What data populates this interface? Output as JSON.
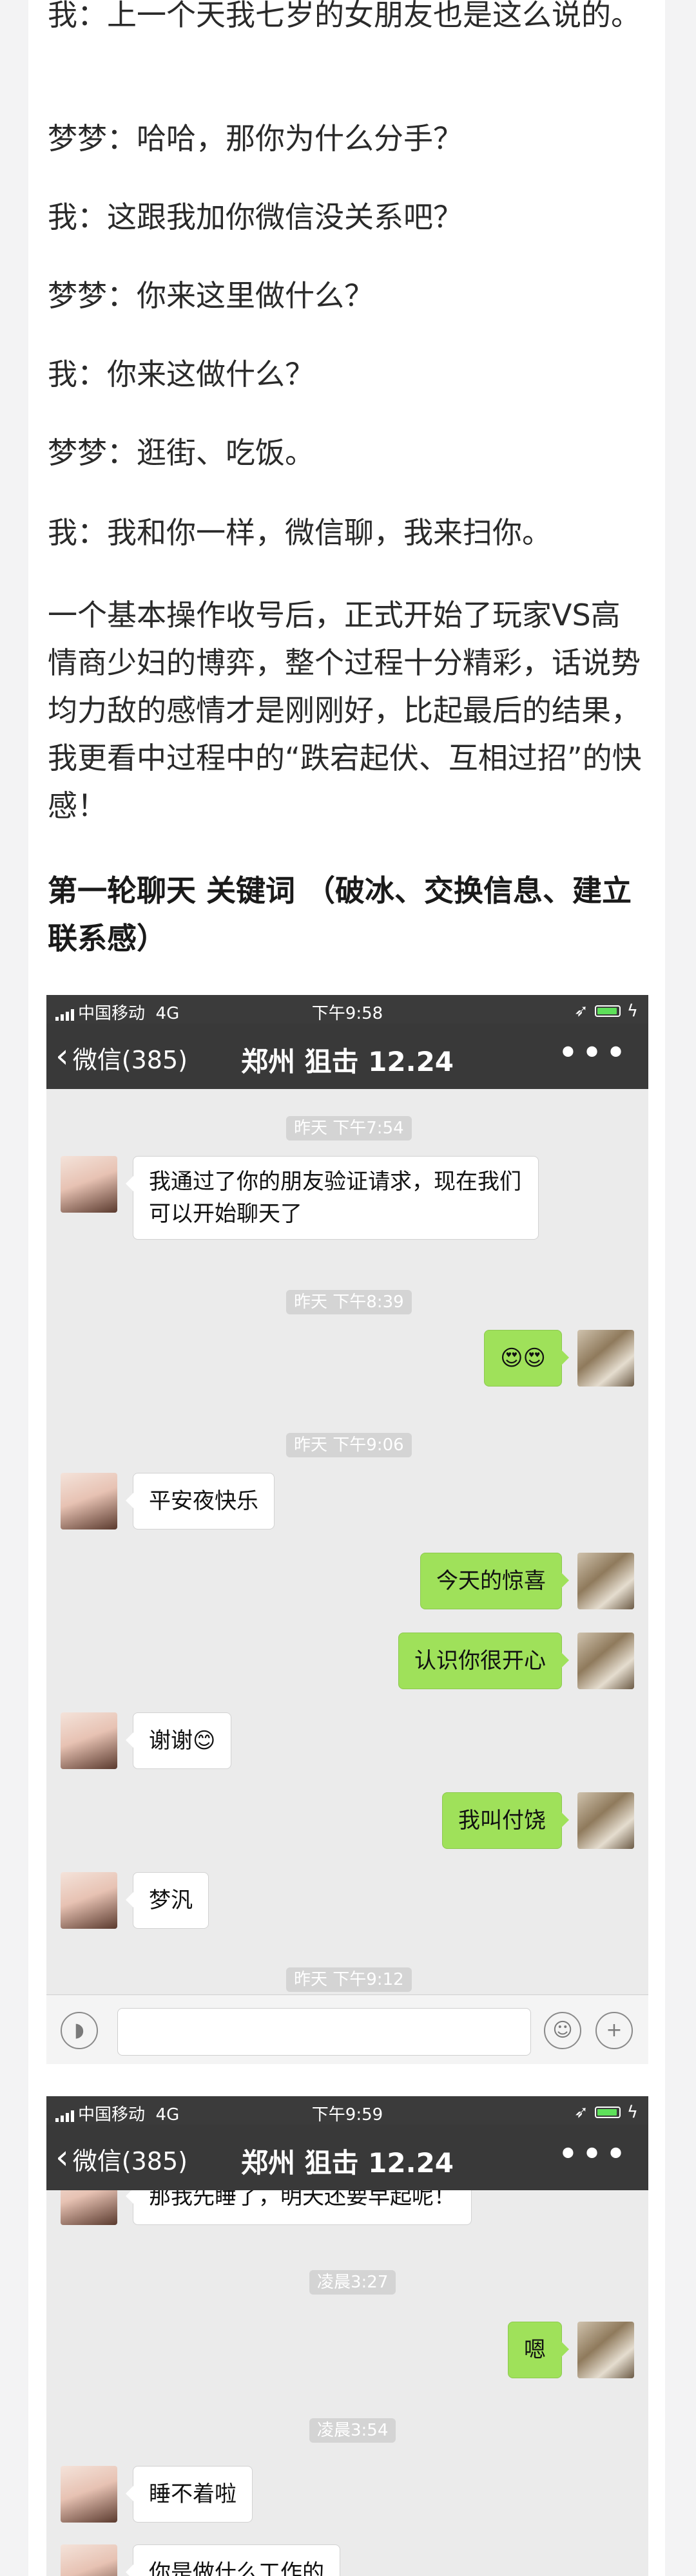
{
  "paragraphs": [
    "我：上一个天我七岁的女朋友也是这么说的。",
    "梦梦：哈哈，那你为什么分手？",
    "我：这跟我加你微信没关系吧？",
    "梦梦：你来这里做什么？",
    "我：你来这做什么？",
    "梦梦：逛街、吃饭。",
    "我：我和你一样，微信聊，我来扫你。",
    " 一个基本操作收号后，正式开始了玩家VS高情商少妇的博弈，整个过程十分精彩，话说势均力敌的感情才是刚刚好，比起最后的结果，我更看中过程中的“跌宕起伏、互相过招”的快感！",
    "第一轮聊天 关键词 （破冰、交换信息、建立联系感）"
  ],
  "screenshot1": {
    "status": {
      "carrier": "中国移动",
      "network": "4G",
      "time": "下午9:58"
    },
    "nav": {
      "back": "微信(385)",
      "title": "郑州 狙击 12.24",
      "more": "•••"
    },
    "timestamps": [
      "昨天 下午7:54",
      "昨天 下午8:39",
      "昨天 下午9:06",
      "昨天 下午9:12"
    ],
    "messages": [
      "我通过了你的朋友验证请求，现在我们可以开始聊天了",
      "😍😍",
      "平安夜快乐",
      "今天的惊喜",
      "认识你很开心",
      "谢谢😊",
      "我叫付饶",
      "梦汎"
    ]
  },
  "screenshot2": {
    "status": {
      "carrier": "中国移动",
      "network": "4G",
      "time": "下午9:59"
    },
    "nav": {
      "back": "微信(385)",
      "title": "郑州 狙击 12.24",
      "more": "•••"
    },
    "timestamps": [
      "凌晨3:27",
      "凌晨3:54"
    ],
    "messages": [
      "那我先睡了，明天还要早起呢！",
      "嗯",
      "睡不着啦",
      "你是做什么工作的"
    ]
  },
  "icons": [
    "voice-icon",
    "emoji-icon",
    "plus-icon",
    "back-chevron-icon",
    "more-icon",
    "battery-icon",
    "signal-icon"
  ],
  "colors": {
    "bubble_out": "#9fe15a",
    "bubble_in": "#ffffff",
    "navbar": "#393939",
    "chat_bg": "#ebebeb"
  }
}
